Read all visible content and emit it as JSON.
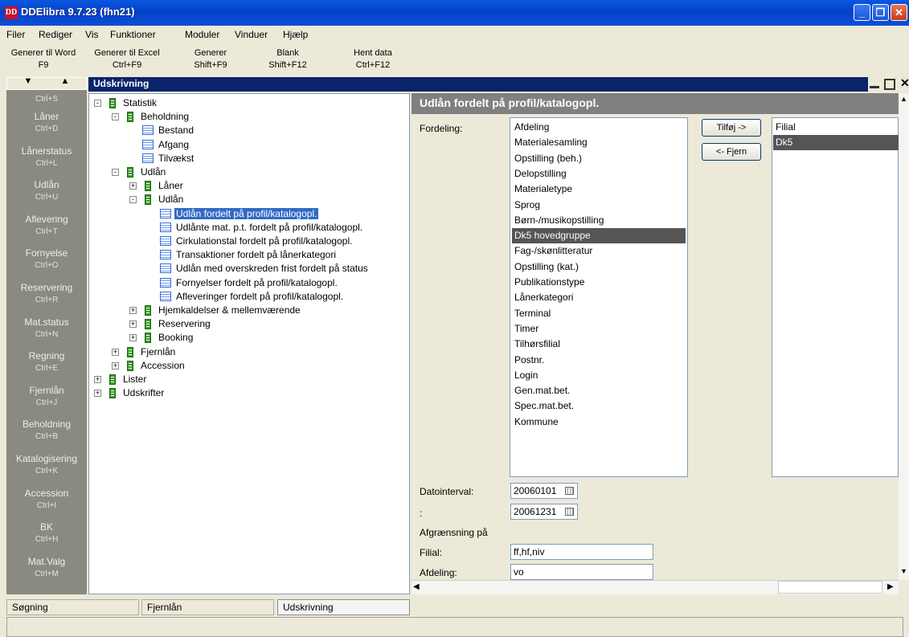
{
  "window": {
    "title": "DDElibra 9.7.23 (fhn21)",
    "icon": "DD",
    "buttons": {
      "minimize": "_",
      "restore": "❐",
      "close": "✕"
    }
  },
  "menu": [
    "Filer",
    "Rediger",
    "Vis",
    "Funktioner",
    "Moduler",
    "Vinduer",
    "Hjælp"
  ],
  "toolbar": [
    {
      "label": "Generer til Word",
      "shortcut": "F9"
    },
    {
      "label": "Generer til Excel",
      "shortcut": "Ctrl+F9"
    },
    {
      "label": "Generer",
      "shortcut": "Shift+F9"
    },
    {
      "label": "Blank",
      "shortcut": "Shift+F12"
    },
    {
      "label": "Hent data",
      "shortcut": "Ctrl+F12"
    }
  ],
  "nav": {
    "top_partial_shortcut": "Ctrl+S",
    "items": [
      {
        "label": "Låner",
        "shortcut": "Ctrl+D"
      },
      {
        "label": "Lånerstatus",
        "shortcut": "Ctrl+L"
      },
      {
        "label": "Udlån",
        "shortcut": "Ctrl+U"
      },
      {
        "label": "Aflevering",
        "shortcut": "Ctrl+T"
      },
      {
        "label": "Fornyelse",
        "shortcut": "Ctrl+O"
      },
      {
        "label": "Reservering",
        "shortcut": "Ctrl+R"
      },
      {
        "label": "Mat.status",
        "shortcut": "Ctrl+N"
      },
      {
        "label": "Regning",
        "shortcut": "Ctrl+E"
      },
      {
        "label": "Fjernlån",
        "shortcut": "Ctrl+J"
      },
      {
        "label": "Beholdning",
        "shortcut": "Ctrl+B"
      },
      {
        "label": "Katalogisering",
        "shortcut": "Ctrl+K"
      },
      {
        "label": "Accession",
        "shortcut": "Ctrl+I"
      },
      {
        "label": "BK",
        "shortcut": "Ctrl+H"
      },
      {
        "label": "Mat.Valg",
        "shortcut": "Ctrl+M"
      }
    ]
  },
  "panel": {
    "header": "Udskrivning"
  },
  "tree": [
    {
      "label": "Statistik",
      "depth": 0,
      "icon": "book",
      "exp": "-"
    },
    {
      "label": "Beholdning",
      "depth": 1,
      "icon": "book",
      "exp": "-"
    },
    {
      "label": "Bestand",
      "depth": 2,
      "icon": "table",
      "exp": ""
    },
    {
      "label": "Afgang",
      "depth": 2,
      "icon": "table",
      "exp": ""
    },
    {
      "label": "Tilvækst",
      "depth": 2,
      "icon": "table",
      "exp": ""
    },
    {
      "label": "Udlån",
      "depth": 1,
      "icon": "book",
      "exp": "-"
    },
    {
      "label": "Låner",
      "depth": 2,
      "icon": "book",
      "exp": "+"
    },
    {
      "label": "Udlån",
      "depth": 2,
      "icon": "book",
      "exp": "-"
    },
    {
      "label": "Udlån fordelt på profil/katalogopl.",
      "depth": 3,
      "icon": "table",
      "exp": "",
      "selected": true
    },
    {
      "label": "Udlånte mat. p.t. fordelt på profil/katalogopl.",
      "depth": 3,
      "icon": "table",
      "exp": ""
    },
    {
      "label": "Cirkulationstal fordelt på profil/katalogopl.",
      "depth": 3,
      "icon": "table",
      "exp": ""
    },
    {
      "label": "Transaktioner fordelt på lånerkategori",
      "depth": 3,
      "icon": "table",
      "exp": ""
    },
    {
      "label": "Udlån med overskreden frist fordelt på status",
      "depth": 3,
      "icon": "table",
      "exp": ""
    },
    {
      "label": "Fornyelser fordelt på profil/katalogopl.",
      "depth": 3,
      "icon": "table",
      "exp": ""
    },
    {
      "label": "Afleveringer fordelt på profil/katalogopl.",
      "depth": 3,
      "icon": "table",
      "exp": ""
    },
    {
      "label": "Hjemkaldelser & mellemværende",
      "depth": 2,
      "icon": "book",
      "exp": "+"
    },
    {
      "label": "Reservering",
      "depth": 2,
      "icon": "book",
      "exp": "+"
    },
    {
      "label": "Booking",
      "depth": 2,
      "icon": "book",
      "exp": "+"
    },
    {
      "label": "Fjernlån",
      "depth": 1,
      "icon": "book",
      "exp": "+"
    },
    {
      "label": "Accession",
      "depth": 1,
      "icon": "book",
      "exp": "+"
    },
    {
      "label": "Lister",
      "depth": 0,
      "icon": "book",
      "exp": "+"
    },
    {
      "label": "Udskrifter",
      "depth": 0,
      "icon": "book",
      "exp": "+"
    }
  ],
  "form": {
    "title": "Udlån fordelt på profil/katalogopl.",
    "fordeling_label": "Fordeling:",
    "available": [
      "Afdeling",
      "Materialesamling",
      "Opstilling (beh.)",
      "Delopstilling",
      "Materialetype",
      "Sprog",
      "Børn-/musikopstilling",
      "Dk5 hovedgruppe",
      "Fag-/skønlitteratur",
      "Opstilling (kat.)",
      "Publikationstype",
      "Lånerkategori",
      "Terminal",
      "Timer",
      "Tilhørsfilial",
      "Postnr.",
      "Login",
      "Gen.mat.bet.",
      "Spec.mat.bet.",
      "Kommune"
    ],
    "available_selected": "Dk5 hovedgruppe",
    "add_button": "Tilføj ->",
    "remove_button": "<- Fjern",
    "chosen": [
      "Filial",
      "Dk5"
    ],
    "chosen_selected": "Dk5",
    "date_label": "Datointerval:",
    "date_from": "20060101",
    "date_sep_label": ":",
    "date_to": "20061231",
    "afgraensning_label": "Afgrænsning på",
    "filial_label": "Filial:",
    "filial_value": "ff,hf,niv",
    "afdeling_label": "Afdeling:",
    "afdeling_value": "vo"
  },
  "bottom_tabs": [
    {
      "label": "Søgning",
      "active": false
    },
    {
      "label": "Fjernlån",
      "active": false
    },
    {
      "label": "Udskrivning",
      "active": true
    }
  ],
  "status": ""
}
